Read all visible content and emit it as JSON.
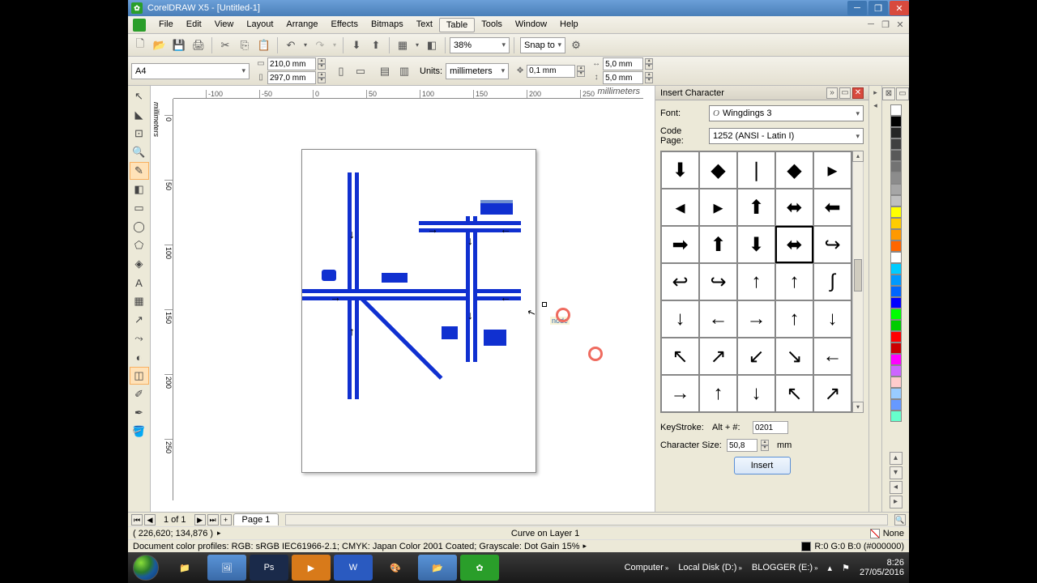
{
  "titlebar": {
    "title": "CorelDRAW X5 - [Untitled-1]"
  },
  "menus": [
    "File",
    "Edit",
    "View",
    "Layout",
    "Arrange",
    "Effects",
    "Bitmaps",
    "Text",
    "Table",
    "Tools",
    "Window",
    "Help"
  ],
  "active_menu_index": 8,
  "toolbar": {
    "zoom": "38%",
    "snap": "Snap to"
  },
  "propbar": {
    "papersize": "A4",
    "width": "210,0 mm",
    "height": "297,0 mm",
    "units_label": "Units:",
    "units": "millimeters",
    "nudge": "0,1 mm",
    "dup_x": "5,0 mm",
    "dup_y": "5,0 mm"
  },
  "ruler_h": {
    "ticks": [
      -100,
      -50,
      0,
      50,
      100,
      150,
      200,
      250
    ],
    "unit": "millimeters"
  },
  "ruler_v": {
    "ticks": [
      0,
      50,
      100,
      150,
      200,
      250
    ],
    "unit": "millimeters"
  },
  "canvas_tooltip": "node",
  "insert_char": {
    "title": "Insert Character",
    "font_label": "Font:",
    "font_value": "Wingdings 3",
    "codepage_label": "Code Page:",
    "codepage_value": "1252  (ANSI - Latin I)",
    "glyphs": [
      "⬇",
      "◆",
      "❘",
      "◆",
      "▸",
      "◂",
      "▸",
      "⬆",
      "⬌",
      "⬅",
      "➡",
      "⬆",
      "⬇",
      "⬌",
      "↪",
      "↩",
      "↪",
      "↑",
      "↑",
      "∫",
      "↓",
      "←",
      "→",
      "↑",
      "↓",
      "↖",
      "↗",
      "↙",
      "↘",
      "←",
      "→",
      "↑",
      "↓",
      "↖",
      "↗"
    ],
    "selected_glyph_index": 13,
    "keystroke_label": "KeyStroke:",
    "altnum_label": "Alt + #:",
    "altnum_value": "0201",
    "charsize_label": "Character Size:",
    "charsize_value": "50,8",
    "charsize_unit": "mm",
    "insert_button": "Insert"
  },
  "palette_colors": [
    "#ffffff",
    "#000000",
    "#262626",
    "#404040",
    "#595959",
    "#737373",
    "#8c8c8c",
    "#a6a6a6",
    "#bfbfbf",
    "#ffff00",
    "#ffcc00",
    "#ff9900",
    "#ff6600",
    "#ffffff",
    "#00ccff",
    "#0099ff",
    "#0066ff",
    "#0000ff",
    "#00ff00",
    "#00cc00",
    "#ff0000",
    "#cc0000",
    "#ff00ff",
    "#cc66ff",
    "#ffcccc",
    "#99ccff",
    "#6699ff",
    "#66ffcc"
  ],
  "pagebar": {
    "count": "1 of 1",
    "tab": "Page 1"
  },
  "status1": {
    "coords": "( 226,620; 134,876 )",
    "hint": "Curve on Layer 1",
    "fill_label": "None",
    "rgb": "R:0 G:0 B:0 (#000000)"
  },
  "status2": {
    "profiles": "Document color profiles: RGB: sRGB IEC61966-2.1; CMYK: Japan Color 2001 Coated; Grayscale: Dot Gain 15%"
  },
  "taskbar": {
    "locations": [
      "Computer",
      "Local Disk (D:)",
      "BLOGGER (E:)"
    ],
    "clock_time": "8:26",
    "clock_date": "27/05/2016"
  }
}
